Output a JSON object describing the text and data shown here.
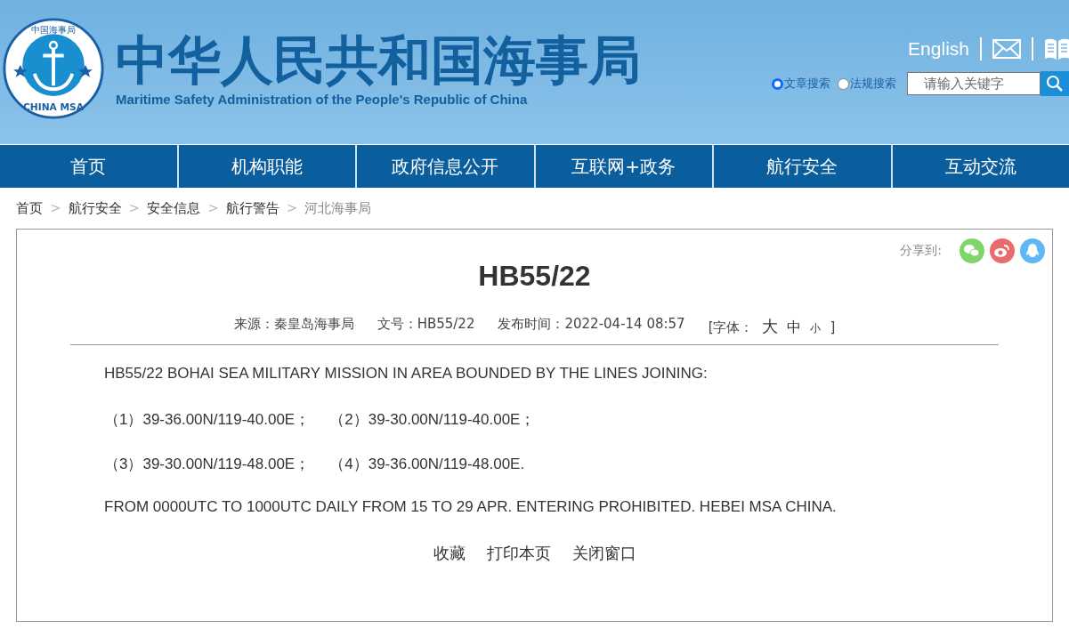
{
  "header": {
    "logo_ring_text": "中国海事局",
    "logo_bottom_text": "CHINA MSA",
    "title": "中华人民共和国海事局",
    "subtitle": "Maritime Safety Administration of the People's Republic of China",
    "language_link": "English",
    "search_options": [
      {
        "label": "文章搜索",
        "selected": true
      },
      {
        "label": "法规搜索",
        "selected": false
      }
    ],
    "search": {
      "placeholder": "请输入关键字"
    }
  },
  "nav": [
    "首页",
    "机构职能",
    "政府信息公开",
    "互联网+政务",
    "航行安全",
    "互动交流"
  ],
  "breadcrumb_separator": ">",
  "breadcrumb": [
    {
      "label": "首页",
      "current": false
    },
    {
      "label": "航行安全",
      "current": false
    },
    {
      "label": "安全信息",
      "current": false
    },
    {
      "label": "航行警告",
      "current": false
    },
    {
      "label": "河北海事局",
      "current": true
    }
  ],
  "article": {
    "share_label": "分享到:",
    "title": "HB55/22",
    "meta": [
      {
        "label": "来源：",
        "value": "秦皇岛海事局"
      },
      {
        "label": "文号：",
        "value": "HB55/22"
      },
      {
        "label": "发布时间：",
        "value": "2022-04-14 08:57"
      }
    ],
    "font_size": {
      "label": "[字体：",
      "options": [
        {
          "label": "大",
          "kind": "large"
        },
        {
          "label": "中",
          "kind": "medium"
        },
        {
          "label": "小",
          "kind": "small"
        }
      ],
      "close": "]"
    },
    "body": [
      [
        "HB55/22 BOHAI SEA MILITARY MISSION IN AREA BOUNDED BY THE LINES JOINING:"
      ],
      [
        "（1）39-36.00N/119-40.00E；",
        "（2）39-30.00N/119-40.00E；"
      ],
      [
        "（3）39-30.00N/119-48.00E；",
        "（4）39-36.00N/119-48.00E."
      ],
      [
        "FROM 0000UTC TO 1000UTC DAILY FROM 15 TO 29 APR. ENTERING PROHIBITED. HEBEI MSA CHINA."
      ]
    ],
    "actions": [
      "收藏",
      "打印本页",
      "关闭窗口"
    ]
  }
}
